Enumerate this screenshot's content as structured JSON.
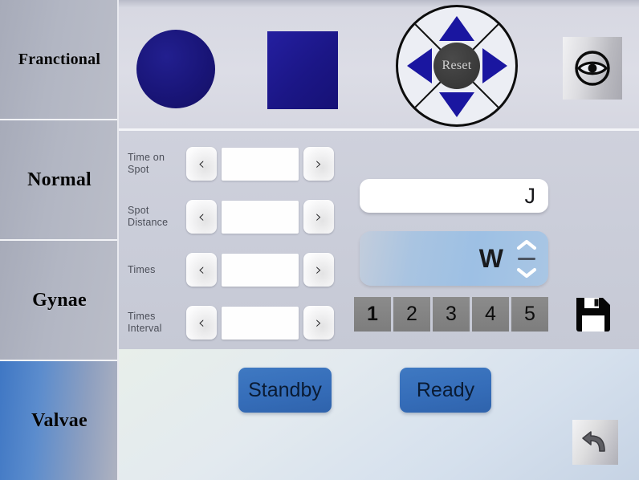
{
  "sidebar": {
    "items": [
      {
        "label": "Franctional",
        "active": false
      },
      {
        "label": "Normal",
        "active": false
      },
      {
        "label": "Gynae",
        "active": false
      },
      {
        "label": "Valvae",
        "active": true
      }
    ]
  },
  "shapes": {
    "circle_icon": "filled-circle-shape",
    "square_icon": "filled-square-shape",
    "shape_color": "#1a16a0"
  },
  "dpad": {
    "center_label": "Reset",
    "up_icon": "triangle-up-icon",
    "down_icon": "triangle-down-icon",
    "left_icon": "triangle-left-icon",
    "right_icon": "triangle-right-icon",
    "arrow_color": "#1a16a0",
    "hub_color": "#3b3b3b"
  },
  "eye_button": {
    "icon": "eye-icon"
  },
  "params": {
    "rows": [
      {
        "label": "Time on Spot",
        "value": "",
        "dec_label": "‹",
        "inc_label": "›"
      },
      {
        "label": "Spot Distance",
        "value": "",
        "dec_label": "‹",
        "inc_label": "›"
      },
      {
        "label": "Times",
        "value": "",
        "dec_label": "‹",
        "inc_label": "›"
      },
      {
        "label": "Times Interval",
        "value": "",
        "dec_label": "‹",
        "inc_label": "›"
      }
    ]
  },
  "energy": {
    "value": "",
    "unit": "J"
  },
  "power": {
    "value": "",
    "unit": "W",
    "up_icon": "chevron-up-icon",
    "down_icon": "chevron-down-icon"
  },
  "presets": {
    "selected": "1",
    "items": [
      "1",
      "2",
      "3",
      "4",
      "5"
    ]
  },
  "save_button": {
    "icon": "floppy-disk-save-icon"
  },
  "actions": {
    "standby_label": "Standby",
    "ready_label": "Ready",
    "button_color": "#356db9"
  },
  "back_button": {
    "icon": "undo-arrow-icon"
  }
}
